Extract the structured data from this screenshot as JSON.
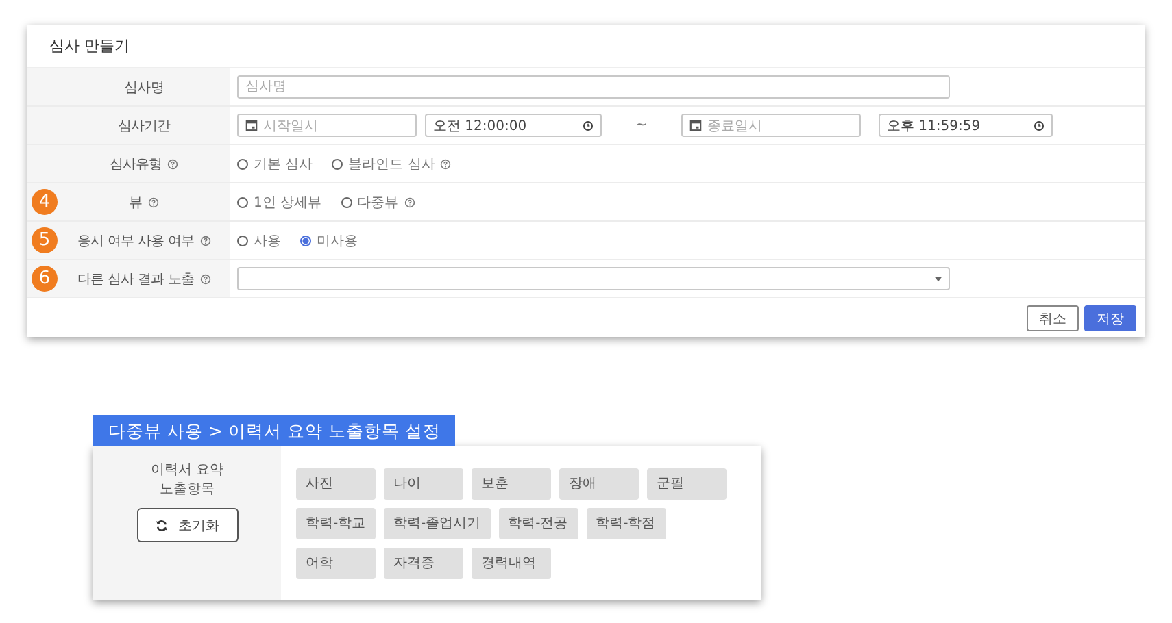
{
  "dialog": {
    "title": "심사 만들기",
    "rows": [
      {
        "kind": "text",
        "label": "심사명",
        "placeholder": "심사명"
      },
      {
        "kind": "period",
        "label": "심사기간",
        "start_placeholder": "시작일시",
        "start_time": "오전 12:00:00",
        "separator": "~",
        "end_placeholder": "종료일시",
        "end_time": "오후 11:59:59"
      },
      {
        "kind": "radio",
        "label": "심사유형",
        "help": true,
        "options": [
          {
            "label": "기본 심사",
            "selected": false
          },
          {
            "label": "블라인드 심사",
            "selected": false,
            "help": true
          }
        ]
      },
      {
        "kind": "radio",
        "marker": "4",
        "label": "뷰",
        "help": true,
        "options": [
          {
            "label": "1인 상세뷰",
            "selected": false
          },
          {
            "label": "다중뷰",
            "selected": false,
            "help": true
          }
        ]
      },
      {
        "kind": "radio",
        "marker": "5",
        "label": "응시 여부 사용 여부",
        "help": true,
        "options": [
          {
            "label": "사용",
            "selected": false
          },
          {
            "label": "미사용",
            "selected": true
          }
        ]
      },
      {
        "kind": "select",
        "marker": "6",
        "label": "다른 심사 결과 노출",
        "help": true
      }
    ],
    "buttons": [
      {
        "label": "취소",
        "primary": false
      },
      {
        "label": "저장",
        "primary": true
      }
    ]
  },
  "section_tab": "다중뷰 사용 > 이력서 요약 노출항목 설정",
  "summary_panel": {
    "label": "이력서 요약 노출항목",
    "reset_button": "초기화",
    "chip_rows": [
      [
        "사진",
        "나이",
        "보훈",
        "장애",
        "군필"
      ],
      [
        "학력-학교",
        "학력-졸업시기",
        "학력-전공",
        "학력-학점"
      ],
      [
        "어학",
        "자격증",
        "경력내역"
      ]
    ]
  }
}
